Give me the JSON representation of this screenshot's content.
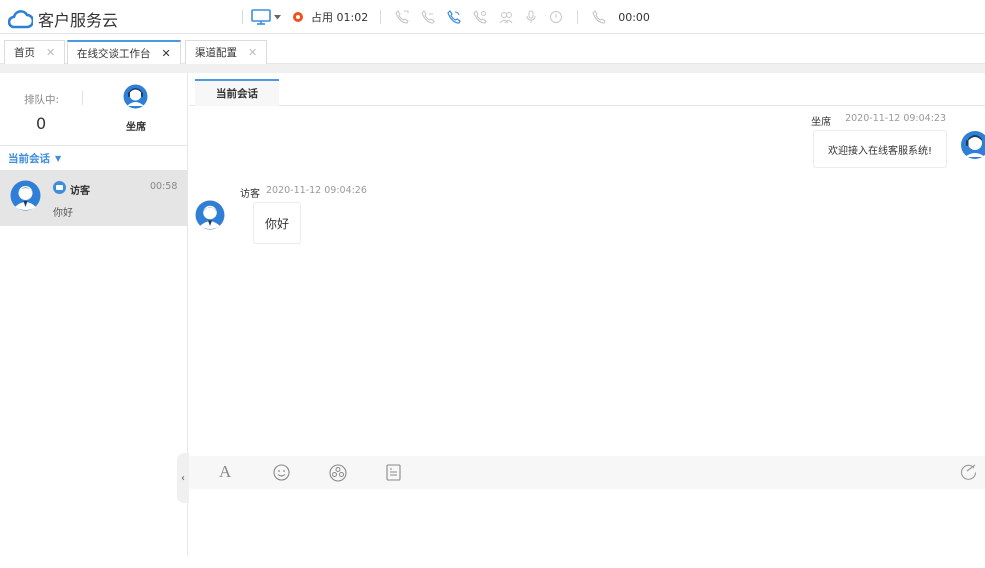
{
  "app": {
    "title": "客户服务云"
  },
  "toolbar": {
    "status_text": "占用 01:02",
    "timer": "00:00",
    "icons": [
      "monitor-icon",
      "caret-down-icon",
      "status-busy-icon",
      "phone-call-icon",
      "phone-transfer-icon",
      "phone-active-icon",
      "phone-conference-icon",
      "consult-icon",
      "mic-icon",
      "hold-icon",
      "phone-hangup-icon"
    ]
  },
  "tabs": [
    {
      "label": "首页",
      "active": false
    },
    {
      "label": "在线交谈工作台",
      "active": true
    },
    {
      "label": "渠道配置",
      "active": false
    }
  ],
  "left_panel": {
    "queue_label": "排队中:",
    "queue_count": "0",
    "agent_label": "坐席",
    "session_header": "当前会话",
    "sessions": [
      {
        "name": "访客",
        "time": "00:58",
        "last_message": "你好"
      }
    ]
  },
  "chat": {
    "tab_label": "当前会话",
    "messages": [
      {
        "sender": "坐席",
        "time": "2020-11-12 09:04:23",
        "text": "欢迎接入在线客服系统!",
        "side": "right"
      },
      {
        "sender": "访客",
        "time": "2020-11-12 09:04:26",
        "text": "你好",
        "side": "left"
      }
    ],
    "editor_tools": [
      "font-icon",
      "emoji-icon",
      "sticker-icon",
      "quick-reply-icon",
      "send-check-icon"
    ]
  },
  "colors": {
    "accent": "#4b9ae0",
    "status_busy": "#f0501e",
    "link": "#3e8ede"
  }
}
